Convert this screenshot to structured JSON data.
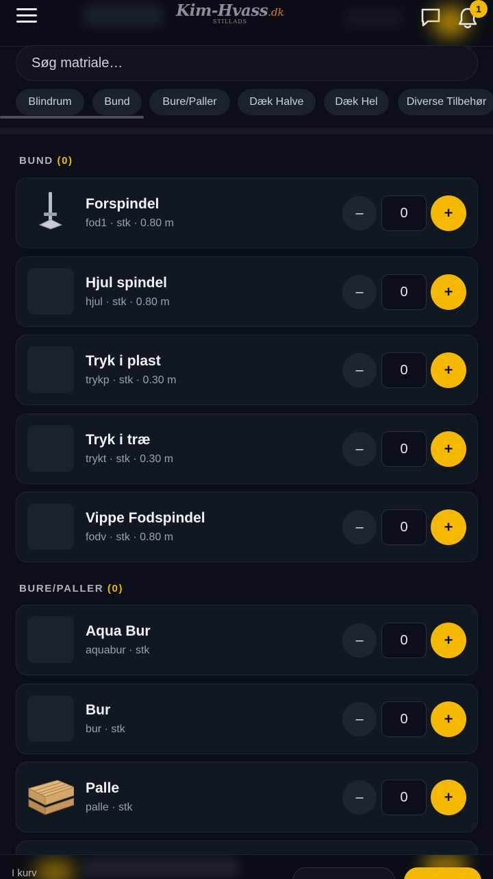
{
  "header": {
    "logo_main": "Kim-Hvass",
    "logo_dk": ".dk",
    "logo_sub": "STILLADS",
    "notification_count": "1",
    "accent": "#f5b800"
  },
  "search": {
    "placeholder": "Søg matriale…"
  },
  "categories": [
    "Blindrum",
    "Bund",
    "Bure/Paller",
    "Dæk Halve",
    "Dæk Hel",
    "Diverse Tilbehør"
  ],
  "sections": [
    {
      "title": "BUND",
      "count": "(0)",
      "items": [
        {
          "name": "Forspindel",
          "meta": "fod1 · stk · 0.80 m",
          "qty": "0",
          "image": "spindle"
        },
        {
          "name": "Hjul spindel",
          "meta": "hjul · stk · 0.80 m",
          "qty": "0",
          "image": ""
        },
        {
          "name": "Tryk i plast",
          "meta": "trykp · stk · 0.30 m",
          "qty": "0",
          "image": ""
        },
        {
          "name": "Tryk i træ",
          "meta": "trykt · stk · 0.30 m",
          "qty": "0",
          "image": ""
        },
        {
          "name": "Vippe Fodspindel",
          "meta": "fodv · stk · 0.80 m",
          "qty": "0",
          "image": ""
        }
      ]
    },
    {
      "title": "BURE/PALLER",
      "count": "(0)",
      "items": [
        {
          "name": "Aqua Bur",
          "meta": "aquabur · stk",
          "qty": "0",
          "image": ""
        },
        {
          "name": "Bur",
          "meta": "bur · stk",
          "qty": "0",
          "image": ""
        },
        {
          "name": "Palle",
          "meta": "palle · stk",
          "qty": "0",
          "image": "pallet"
        }
      ]
    }
  ],
  "controls": {
    "minus": "–",
    "plus": "+"
  },
  "bottom_bar": {
    "basket_label": "I kurv"
  }
}
